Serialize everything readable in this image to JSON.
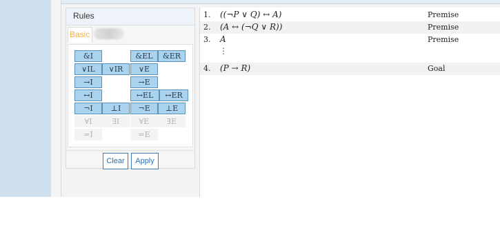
{
  "rules": {
    "header": "Rules",
    "tabs": [
      {
        "label": "Basic"
      }
    ],
    "buttons": [
      {
        "label": "&I",
        "disabled": false
      },
      {
        "label": "&EL",
        "disabled": false
      },
      {
        "label": "&ER",
        "disabled": false
      },
      {
        "label": "∨IL",
        "disabled": false
      },
      {
        "label": "∨IR",
        "disabled": false
      },
      {
        "label": "∨E",
        "disabled": false
      },
      {
        "label": "→I",
        "disabled": false
      },
      {
        "label": "→E",
        "disabled": false
      },
      {
        "label": "↔I",
        "disabled": false
      },
      {
        "label": "↔EL",
        "disabled": false
      },
      {
        "label": "↔ER",
        "disabled": false
      },
      {
        "label": "¬I",
        "disabled": false
      },
      {
        "label": "⊥I",
        "disabled": false
      },
      {
        "label": "¬E",
        "disabled": false
      },
      {
        "label": "⊥E",
        "disabled": false
      },
      {
        "label": "∀I",
        "disabled": true
      },
      {
        "label": "∃I",
        "disabled": true
      },
      {
        "label": "∀E",
        "disabled": true
      },
      {
        "label": "∃E",
        "disabled": true
      },
      {
        "label": "=I",
        "disabled": true
      },
      {
        "label": "=E",
        "disabled": true
      }
    ],
    "clear_label": "Clear",
    "apply_label": "Apply"
  },
  "proof": {
    "lines": [
      {
        "num": "1.",
        "formula": "((¬P ∨ Q) ↔ A)",
        "justification": "Premise"
      },
      {
        "num": "2.",
        "formula": "(A ↔ (¬Q ∨ R))",
        "justification": "Premise"
      },
      {
        "num": "3.",
        "formula": "A",
        "justification": "Premise"
      },
      {
        "num": "4.",
        "formula": "(P → R)",
        "justification": "Goal"
      }
    ],
    "ellipsis": "⋮"
  }
}
